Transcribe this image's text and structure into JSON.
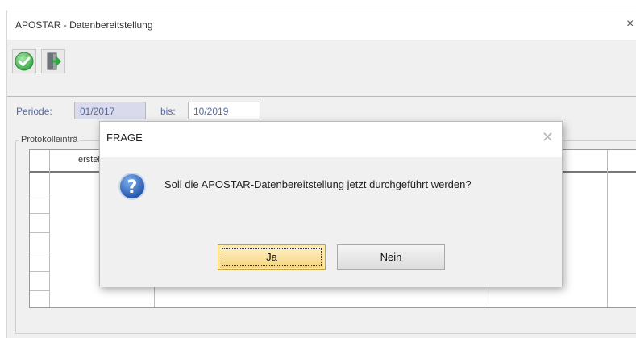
{
  "window": {
    "title": "APOSTAR - Datenbereitstellung",
    "close_glyph": "×"
  },
  "toolbar": {
    "buttons": [
      {
        "icon": "check-circle-icon",
        "color": "#4cbb5a"
      },
      {
        "icon": "exit-door-icon",
        "color": "#2f9a3c"
      }
    ]
  },
  "period": {
    "label": "Periode:",
    "from_value": "01/2017",
    "to_label": "bis:",
    "to_value": "10/2019"
  },
  "protocol": {
    "legend": "Protokolleinträ",
    "columns": [
      "erstel"
    ]
  },
  "dialog": {
    "title": "FRAGE",
    "close_glyph": "✕",
    "icon": "question-icon",
    "message": "Soll die APOSTAR-Datenbereitstellung jetzt durchgeführt werden?",
    "yes_label": "Ja",
    "no_label": "Nein"
  },
  "colors": {
    "accent_yes": "#f4d27a",
    "question_icon_blue": "#1f5fb8"
  }
}
